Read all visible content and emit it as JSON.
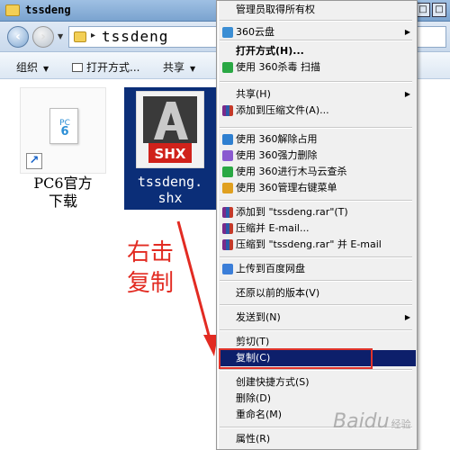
{
  "window": {
    "title": "tssdeng"
  },
  "address": {
    "path": "tssdeng"
  },
  "toolbar": {
    "organize": "组织",
    "open_with": "打开方式...",
    "share": "共享"
  },
  "files": [
    {
      "label_line1": "PC6官方",
      "label_line2": "下载",
      "icon_text": "PC",
      "icon_num": "6"
    },
    {
      "label_line1": "tssdeng.",
      "label_line2": "shx",
      "icon_text": "SHX"
    }
  ],
  "annotation": {
    "line1": "右击",
    "line2": "复制"
  },
  "context_menu": {
    "items": [
      {
        "label": "管理员取得所有权"
      },
      {
        "label": "360云盘",
        "icon": "cloud-icon",
        "submenu": true
      },
      {
        "label": "打开方式(H)...",
        "bold": true
      },
      {
        "label": "使用 360杀毒 扫描",
        "icon": "shield-icon"
      },
      {
        "label": "共享(H)",
        "submenu": true
      },
      {
        "label": "添加到压缩文件(A)...",
        "icon": "winrar-icon"
      },
      {
        "label": "使用 360解除占用",
        "icon": "unlock-icon"
      },
      {
        "label": "使用 360强力删除",
        "icon": "force-delete-icon"
      },
      {
        "label": "使用 360进行木马云查杀",
        "icon": "trojan-scan-icon"
      },
      {
        "label": "使用 360管理右键菜单",
        "icon": "menu-manage-icon"
      },
      {
        "label": "添加到 \"tssdeng.rar\"(T)",
        "icon": "winrar-icon"
      },
      {
        "label": "压缩并 E-mail...",
        "icon": "winrar-icon"
      },
      {
        "label": "压缩到 \"tssdeng.rar\" 并 E-mail",
        "icon": "winrar-icon"
      },
      {
        "label": "上传到百度网盘",
        "icon": "baidu-pan-icon"
      },
      {
        "label": "还原以前的版本(V)"
      },
      {
        "label": "发送到(N)",
        "submenu": true
      },
      {
        "label": "剪切(T)"
      },
      {
        "label": "复制(C)",
        "highlighted": true
      },
      {
        "label": "创建快捷方式(S)"
      },
      {
        "label": "删除(D)"
      },
      {
        "label": "重命名(M)"
      },
      {
        "label": "属性(R)"
      }
    ]
  },
  "watermark": {
    "text": "Baidu",
    "sub": "经验"
  },
  "colors": {
    "highlight": "#0d1f6b",
    "annotation_red": "#e22b22",
    "selection": "#0b2e78"
  }
}
